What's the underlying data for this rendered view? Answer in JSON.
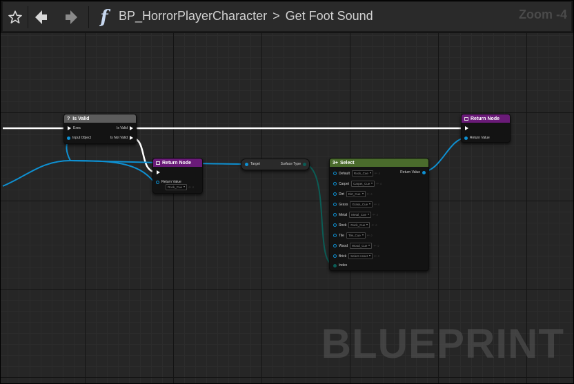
{
  "toolbar": {
    "favorite_icon": "star-icon",
    "back_icon": "arrow-left-icon",
    "forward_icon": "arrow-right-icon",
    "function_icon": "function-f-icon",
    "breadcrumb": [
      "BP_HorrorPlayerCharacter",
      "Get Foot Sound"
    ],
    "zoom": "Zoom -4"
  },
  "nodes": {
    "is_valid": {
      "title_icon": "?",
      "title": "Is Valid",
      "pins": {
        "exec": "Exec",
        "input_object": "Input Object",
        "is_valid": "Is Valid",
        "is_not_valid": "Is Not Valid"
      }
    },
    "return_node_a": {
      "title": "Return Node",
      "return_label": "Return Value",
      "return_value": "Rock_Cue"
    },
    "get_surface": {
      "target": "Target",
      "surface_type": "Surface Type"
    },
    "select": {
      "title_icon": "3+",
      "title": "Select",
      "return_label": "Return Value",
      "index_label": "Index",
      "options": [
        {
          "label": "Default",
          "value": "Rock_Cue"
        },
        {
          "label": "Carpet",
          "value": "Carpet_Cue"
        },
        {
          "label": "Dirt",
          "value": "Dirt_Cue"
        },
        {
          "label": "Grass",
          "value": "Grass_Cue"
        },
        {
          "label": "Metal",
          "value": "Metal_Cue"
        },
        {
          "label": "Rock",
          "value": "Rock_Cue"
        },
        {
          "label": "Tile",
          "value": "Tile_Cue"
        },
        {
          "label": "Wood",
          "value": "Wood_Cue"
        },
        {
          "label": "Brick",
          "value": "Select Asset"
        }
      ]
    },
    "return_node_b": {
      "title": "Return Node",
      "return_label": "Return Value"
    }
  },
  "colors": {
    "exec_wire": "#ffffff",
    "object_wire": "#0e91d3",
    "enum_wire": "#0b5c55",
    "return_header": "#6a1b78",
    "select_header": "#4a6b2c",
    "isvalid_header": "#5c5c5c"
  },
  "watermark": "BLUEPRINT"
}
